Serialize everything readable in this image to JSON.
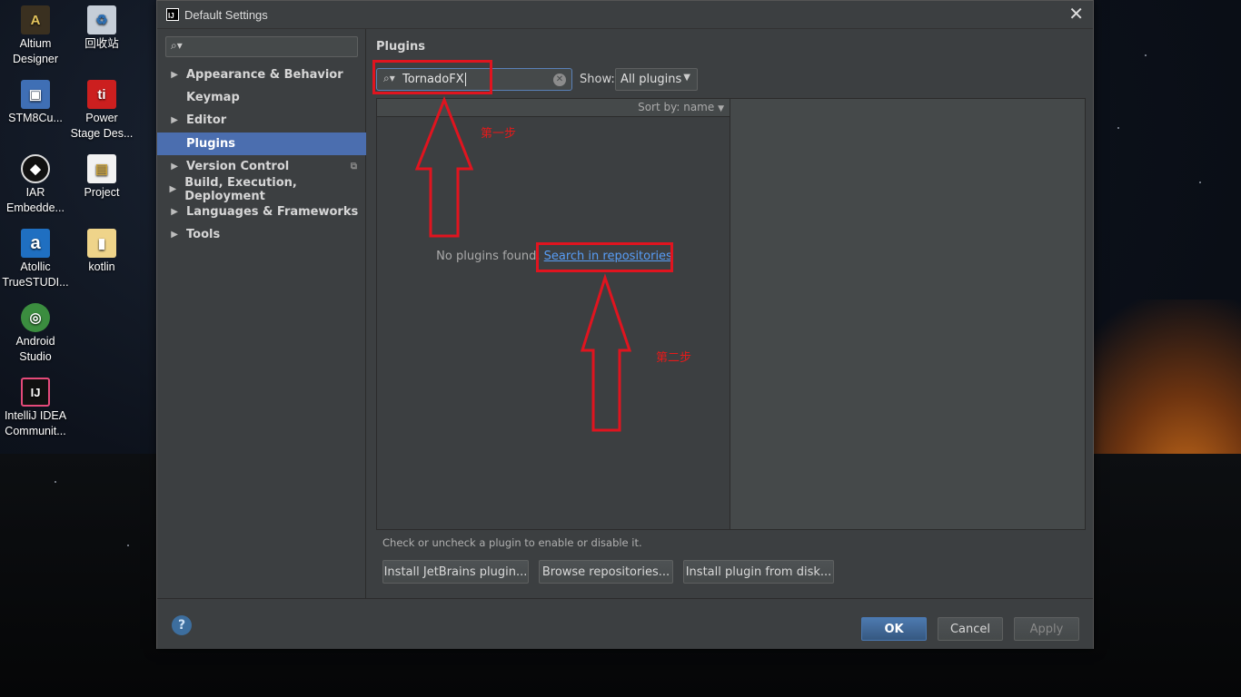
{
  "desktop_icons": [
    {
      "label_line1": "Altium",
      "label_line2": "Designer",
      "icon": "altium-icon",
      "letter": "A",
      "color": "#c9a84a"
    },
    {
      "label_line1": "回收站",
      "label_line2": "",
      "icon": "recycle-bin-icon",
      "letter": "♻",
      "color": "#9aa7b8"
    },
    {
      "label_line1": "STM8Cu...",
      "label_line2": "",
      "icon": "stm8-icon",
      "letter": "▣",
      "color": "#3f6fb5"
    },
    {
      "label_line1": "Power",
      "label_line2": "Stage Des...",
      "icon": "ti-icon",
      "letter": "ti",
      "color": "#cc1f1f"
    },
    {
      "label_line1": "IAR",
      "label_line2": "Embedde...",
      "icon": "iar-icon",
      "letter": "◆",
      "color": "#222"
    },
    {
      "label_line1": "Project",
      "label_line2": "",
      "icon": "file-icon",
      "letter": "▤",
      "color": "#e8d58a"
    },
    {
      "label_line1": "Atollic",
      "label_line2": "TrueSTUDI...",
      "icon": "atollic-icon",
      "letter": "a",
      "color": "#1f6fc1"
    },
    {
      "label_line1": "kotlin",
      "label_line2": "",
      "icon": "folder-icon",
      "letter": "▮",
      "color": "#e9c86a"
    },
    {
      "label_line1": "Android",
      "label_line2": "Studio",
      "icon": "android-studio-icon",
      "letter": "◎",
      "color": "#4caf50"
    },
    {
      "label_line1": "IntelliJ IDEA",
      "label_line2": "Communit...",
      "icon": "intellij-icon",
      "letter": "IJ",
      "color": "#111"
    }
  ],
  "dialog": {
    "title": "Default Settings",
    "logo_text": "IJ",
    "close_glyph": "✕"
  },
  "sidebar": {
    "search_icon_glyph": "🔍",
    "items": [
      {
        "label": "Appearance & Behavior",
        "expandable": true
      },
      {
        "label": "Keymap",
        "expandable": false
      },
      {
        "label": "Editor",
        "expandable": true
      },
      {
        "label": "Plugins",
        "expandable": false,
        "selected": true
      },
      {
        "label": "Version Control",
        "expandable": true,
        "copy_icon": true
      },
      {
        "label": "Build, Execution, Deployment",
        "expandable": true
      },
      {
        "label": "Languages & Frameworks",
        "expandable": true
      },
      {
        "label": "Tools",
        "expandable": true
      }
    ]
  },
  "plugins": {
    "title": "Plugins",
    "search_value": "TornadoFX",
    "show_label": "Show:",
    "show_value": "All plugins",
    "sort_label": "Sort by: name",
    "empty_text": "No plugins found.",
    "search_link": "Search in repositories",
    "hint": "Check or uncheck a plugin to enable or disable it.",
    "buttons": {
      "install_jetbrains": "Install JetBrains plugin...",
      "browse": "Browse repositories...",
      "install_disk": "Install plugin from disk..."
    }
  },
  "footer": {
    "help": "?",
    "ok": "OK",
    "cancel": "Cancel",
    "apply": "Apply"
  },
  "annotations": {
    "step1": "第一步",
    "step2": "第二步",
    "color": "#e0141f"
  }
}
